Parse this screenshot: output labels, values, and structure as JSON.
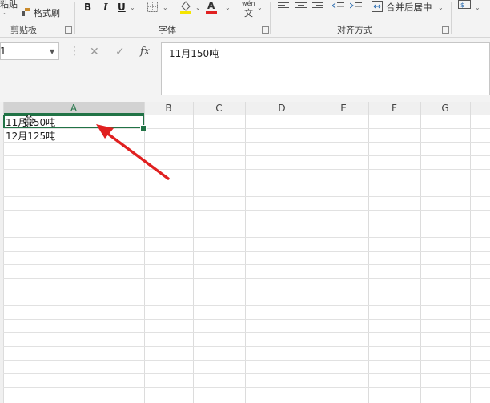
{
  "ribbon": {
    "clipboard": {
      "paste_label": "粘贴",
      "format_painter_label": "格式刷",
      "group_label": "剪贴板"
    },
    "font": {
      "bold": "B",
      "italic": "I",
      "underline": "U",
      "font_color_glyph": "A",
      "phonetic_top": "wén",
      "phonetic_bottom": "文",
      "group_label": "字体"
    },
    "alignment": {
      "merge_center_label": "合并后居中",
      "group_label": "对齐方式"
    }
  },
  "namebox": {
    "value": "1"
  },
  "formula_bar": {
    "cancel_glyph": "✕",
    "enter_glyph": "✓",
    "fx_glyph": "fx",
    "value": "11月150吨"
  },
  "sheet": {
    "columns": [
      "A",
      "B",
      "C",
      "D",
      "E",
      "F",
      "G"
    ],
    "cells": {
      "A1": "11月150吨",
      "A2": "12月125吨"
    }
  },
  "colors": {
    "accent": "#217346",
    "arrow": "#e02020"
  }
}
